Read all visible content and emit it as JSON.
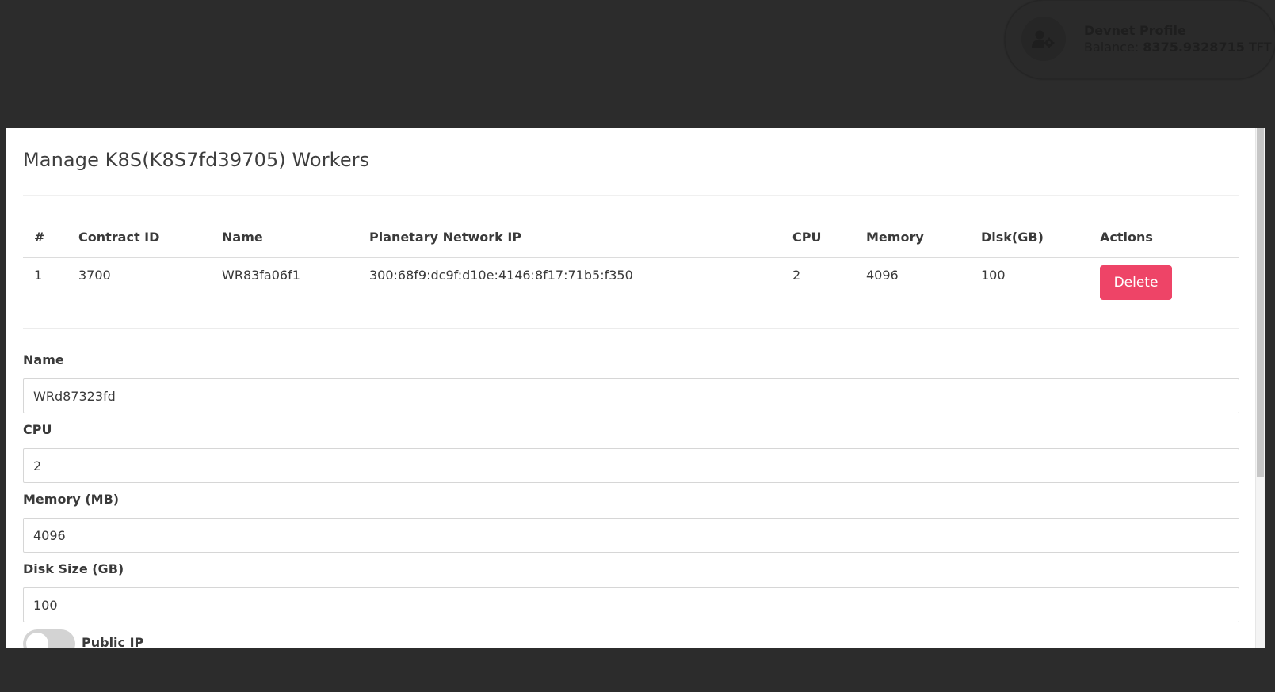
{
  "profile": {
    "title": "Devnet Profile",
    "balance_label": "Balance:",
    "balance_amount": "8375.9328715",
    "balance_unit": "TFT",
    "icon": "user-gear-icon"
  },
  "dialog": {
    "title": "Manage K8S(K8S7fd39705) Workers"
  },
  "table": {
    "headers": [
      "#",
      "Contract ID",
      "Name",
      "Planetary Network IP",
      "CPU",
      "Memory",
      "Disk(GB)",
      "Actions"
    ],
    "rows": [
      {
        "index": "1",
        "contract_id": "3700",
        "name": "WR83fa06f1",
        "planetary_ip": "300:68f9:dc9f:d10e:4146:8f17:71b5:f350",
        "cpu": "2",
        "memory": "4096",
        "disk": "100",
        "action_label": "Delete"
      }
    ]
  },
  "form": {
    "name_label": "Name",
    "name_value": "WRd87323fd",
    "cpu_label": "CPU",
    "cpu_value": "2",
    "memory_label": "Memory (MB)",
    "memory_value": "4096",
    "disk_label": "Disk Size (GB)",
    "disk_value": "100",
    "public_ip_label": "Public IP",
    "public_ip_enabled": false
  },
  "colors": {
    "background": "#2c2c2c",
    "delete_button": "#ee4467",
    "dialog": "#ffffff"
  }
}
